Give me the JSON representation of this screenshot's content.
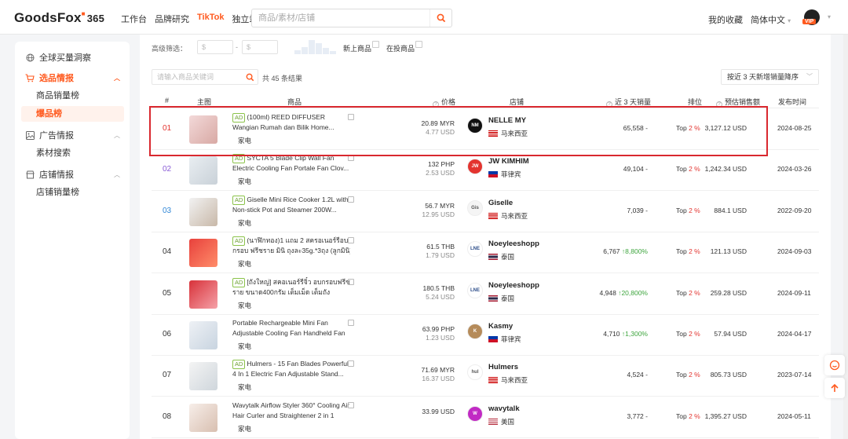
{
  "nav": {
    "logo_text": "GoodsFox",
    "logo_suffix": "365",
    "links": [
      "工作台",
      "品牌研究",
      "TikTok",
      "独立站"
    ],
    "search_placeholder": "商品/素材/店铺",
    "favorites": "我的收藏",
    "language": "简体中文",
    "vip_badge": "VIP"
  },
  "sidebar": {
    "top_item": "全球买量洞察",
    "groups": [
      {
        "label": "选品情报",
        "items": [
          "商品销量榜",
          "爆品榜"
        ]
      },
      {
        "label": "广告情报",
        "items": [
          "素材搜索"
        ]
      },
      {
        "label": "店铺情报",
        "items": [
          "店铺销量榜"
        ]
      }
    ],
    "active_item": "爆品榜"
  },
  "filters": {
    "label": "高级筛选：",
    "min_placeholder": "$",
    "max_placeholder": "$",
    "range_sep": "-",
    "new_product": "新上商品",
    "active_ads": "在投商品"
  },
  "toolbar": {
    "keyword_placeholder": "请输入商品关键词",
    "total": "共 45 条结果",
    "sort": "按近 3 天新增销量降序"
  },
  "columns": {
    "rank": "#",
    "image": "主图",
    "product": "商品",
    "price": "价格",
    "shop": "店铺",
    "sales": "近 3 天销量",
    "ranking": "排位",
    "gmv": "预估销售额",
    "date": "发布时间"
  },
  "rows": [
    {
      "rank": "01",
      "ad": "AD",
      "line1": "(100ml) REED DIFFUSER",
      "line2": "Wangian Rumah dan Bilik Home...",
      "category": "家电",
      "price": "20.89 MYR",
      "price_usd": "4.77 USD",
      "shop": "NELLE MY",
      "country": "马来西亚",
      "sales": "65,558",
      "growth": "-",
      "top_label": "Top",
      "top_pct": "2 %",
      "gmv": "3,127.12 USD",
      "date": "2024-08-25"
    },
    {
      "rank": "02",
      "ad": "AD",
      "line1": "SYCTA 5 Blade Clip Wall Fan",
      "line2": "Electric Cooling Fan Portale Fan Clov...",
      "category": "家电",
      "price": "132 PHP",
      "price_usd": "2.53 USD",
      "shop": "JW KIMHIM",
      "country": "菲律宾",
      "sales": "49,104",
      "growth": "-",
      "top_label": "Top",
      "top_pct": "2 %",
      "gmv": "1,242.34 USD",
      "date": "2024-03-26"
    },
    {
      "rank": "03",
      "ad": "AD",
      "line1": "Giselle Mini Rice Cooker 1.2L with",
      "line2": "Non-stick Pot and Steamer 200W...",
      "category": "家电",
      "price": "56.7 MYR",
      "price_usd": "12.95 USD",
      "shop": "Giselle",
      "country": "马来西亚",
      "sales": "7,039",
      "growth": "-",
      "top_label": "Top",
      "top_pct": "2 %",
      "gmv": "884.1 USD",
      "date": "2022-09-20"
    },
    {
      "rank": "04",
      "ad": "AD",
      "line1": "(นาฬิกทอง)1 แถม 2 สครอเนอร์รีอบ",
      "line2": "กรอบ ฟรีชราย มินิ ถุงละ35g.*3ถุง (ลูกมินิ)",
      "category": "家电",
      "price": "61.5 THB",
      "price_usd": "1.79 USD",
      "shop": "Noeyleeshopp",
      "country": "泰国",
      "sales": "6,767",
      "growth": "8,800%",
      "top_label": "Top",
      "top_pct": "2 %",
      "gmv": "121.13 USD",
      "date": "2024-09-03"
    },
    {
      "rank": "05",
      "ad": "AD",
      "line1": "[ถังใหญ่] สคอเนอร์รีจิ๋ว อบกรอบฟรีชล",
      "line2": "ราย ขนาด400กรัม เต็มเม็ด เต็มถัง",
      "category": "家电",
      "price": "180.5 THB",
      "price_usd": "5.24 USD",
      "shop": "Noeyleeshopp",
      "country": "泰国",
      "sales": "4,948",
      "growth": "20,800%",
      "top_label": "Top",
      "top_pct": "2 %",
      "gmv": "259.28 USD",
      "date": "2024-09-11"
    },
    {
      "rank": "06",
      "ad": "",
      "line1": "Portable Rechargeable Mini Fan",
      "line2": "Adjustable Cooling Fan Handheld Fan",
      "category": "家电",
      "price": "63.99 PHP",
      "price_usd": "1.23 USD",
      "shop": "Kasmy",
      "country": "菲律宾",
      "sales": "4,710",
      "growth": "1,300%",
      "top_label": "Top",
      "top_pct": "2 %",
      "gmv": "57.94 USD",
      "date": "2024-04-17"
    },
    {
      "rank": "07",
      "ad": "AD",
      "line1": "Hulmers - 15 Fan Blades Powerful",
      "line2": "4 In 1 Electric Fan Adjustable Stand...",
      "category": "家电",
      "price": "71.69 MYR",
      "price_usd": "16.37 USD",
      "shop": "Hulmers",
      "country": "马来西亚",
      "sales": "4,524",
      "growth": "-",
      "top_label": "Top",
      "top_pct": "2 %",
      "gmv": "805.73 USD",
      "date": "2023-07-14"
    },
    {
      "rank": "08",
      "ad": "",
      "line1": "Wavytalk Airflow Styler 360° Cooling Air",
      "line2": "Hair Curler and Straightener 2 in 1",
      "category": "家电",
      "price": "33.99 USD",
      "price_usd": "",
      "shop": "wavytalk",
      "country": "美国",
      "sales": "3,772",
      "growth": "-",
      "top_label": "Top",
      "top_pct": "2 %",
      "gmv": "1,395.27 USD",
      "date": "2024-05-11"
    }
  ],
  "icons": {
    "search": "search-icon",
    "globe": "globe-icon",
    "cart": "cart-icon",
    "image": "image-icon",
    "store": "store-icon",
    "copy": "copy-icon",
    "chat": "chat-icon",
    "arrow_up": "arrow-up-icon"
  },
  "colors": {
    "accent": "#ff5a1f",
    "highlight": "#d9282f",
    "ad_badge": "#6a9e2f",
    "growth": "#3ea53e",
    "top_pct": "#e3342f"
  }
}
